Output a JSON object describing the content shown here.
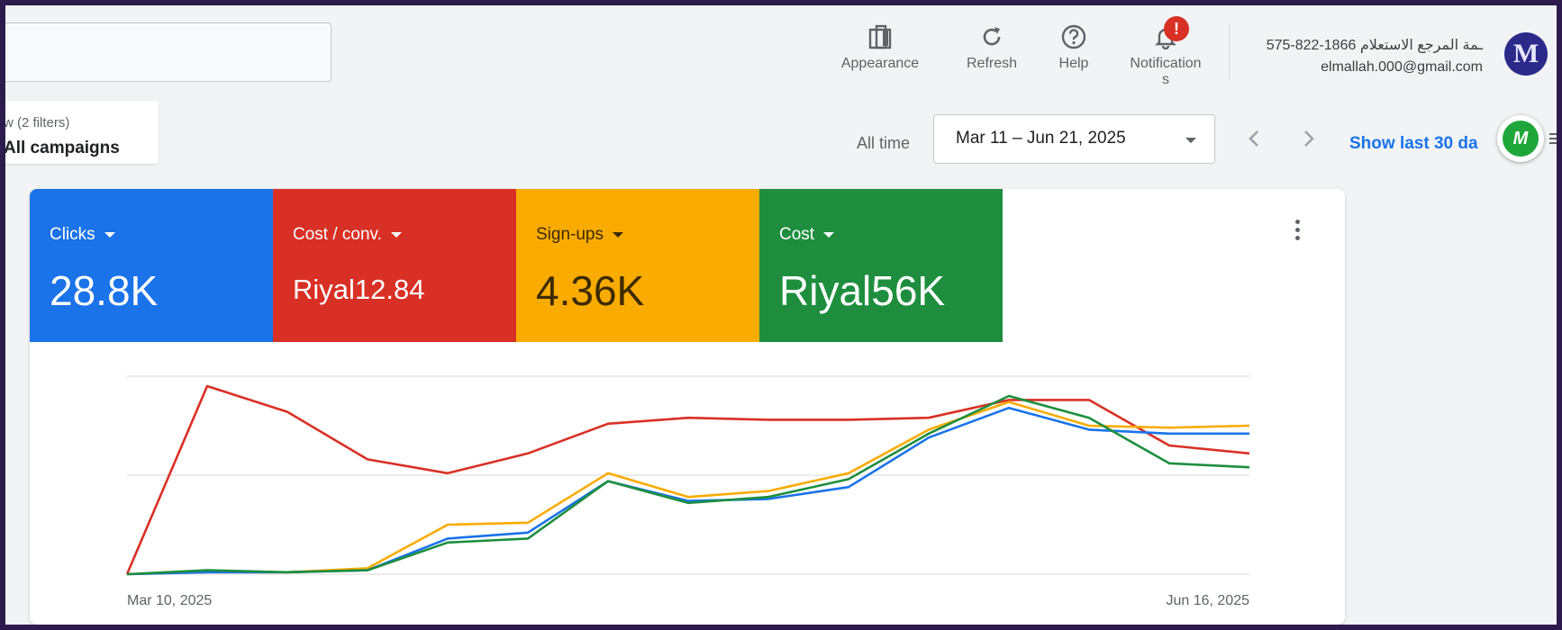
{
  "header": {
    "toolbar": [
      {
        "label": "Appearance",
        "icon": "appearance-icon"
      },
      {
        "label": "Refresh",
        "icon": "refresh-icon"
      },
      {
        "label": "Help",
        "icon": "help-icon"
      },
      {
        "label": "Notification\ns",
        "icon": "bell-icon"
      }
    ],
    "notification_badge": "!",
    "account": {
      "line1": "575-822-1866 ـمة المرجع الاستعلام",
      "email": "elmallah.000@gmail.com",
      "avatar_letter": "M"
    }
  },
  "filters": {
    "view_label": "w (2 filters)",
    "campaigns_label": "All campaigns"
  },
  "date_range": {
    "preset_label": "All time",
    "range": "Mar 11 – Jun 21, 2025",
    "show_last_link": "Show last 30 da",
    "assistant_avatar_letter": "M"
  },
  "metrics": [
    {
      "label": "Clicks",
      "value": "28.8K",
      "color": "#1a73e8"
    },
    {
      "label": "Cost / conv.",
      "value": "Riyal12.84",
      "color": "#d93025"
    },
    {
      "label": "Sign-ups",
      "value": "4.36K",
      "color": "#f9ab00"
    },
    {
      "label": "Cost",
      "value": "Riyal56K",
      "color": "#1e8e3e"
    }
  ],
  "chart_data": {
    "type": "line",
    "x_start_label": "Mar 10, 2025",
    "x_end_label": "Jun 16, 2025",
    "ylim": [
      0,
      100
    ],
    "grid": true,
    "series": [
      {
        "name": "Cost / conv.",
        "color": "#d93025",
        "values": [
          0,
          95,
          82,
          58,
          51,
          61,
          76,
          79,
          78,
          78,
          79,
          88,
          88,
          65,
          61
        ]
      },
      {
        "name": "Sign-ups",
        "color": "#f9ab00",
        "values": [
          0,
          1,
          1,
          3,
          25,
          26,
          51,
          39,
          42,
          51,
          73,
          87,
          75,
          74,
          75
        ]
      },
      {
        "name": "Clicks",
        "color": "#1a73e8",
        "values": [
          0,
          1,
          1,
          2,
          18,
          21,
          47,
          37,
          38,
          44,
          69,
          84,
          73,
          71,
          71
        ]
      },
      {
        "name": "Cost",
        "color": "#1e8e3e",
        "values": [
          0,
          2,
          1,
          2,
          16,
          18,
          47,
          36,
          39,
          48,
          71,
          90,
          79,
          56,
          54
        ]
      }
    ]
  }
}
